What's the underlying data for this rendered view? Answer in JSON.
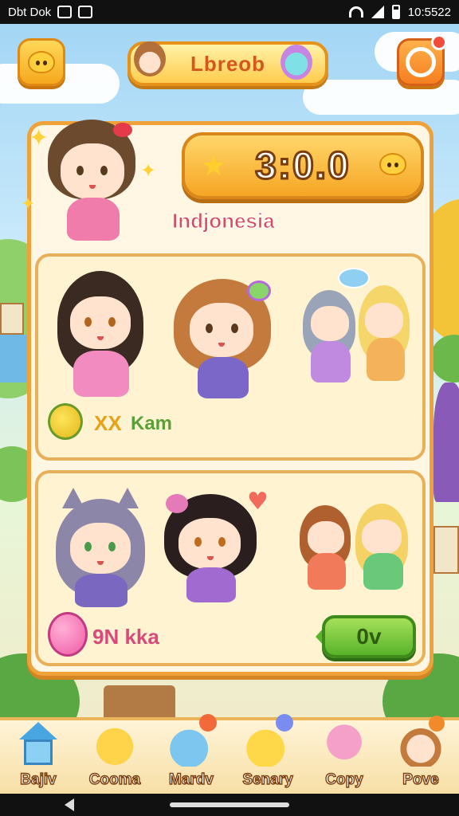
{
  "statusbar": {
    "left_text": "Dbt Dok",
    "time": "10:5522"
  },
  "header": {
    "title": "Lbreob"
  },
  "score": {
    "value": "3:0.0"
  },
  "profile": {
    "country": "Indjonesia"
  },
  "cards": [
    {
      "label": "Kam",
      "badge": "XX"
    },
    {
      "label": "9N kka"
    }
  ],
  "action_button": {
    "label": "0v"
  },
  "bottom_nav": [
    {
      "label": "Bajiv",
      "icon": "house-icon"
    },
    {
      "label": "Cooma",
      "icon": "cat-icon"
    },
    {
      "label": "Mardv",
      "icon": "bear-balloon-icon"
    },
    {
      "label": "Senary",
      "icon": "dog-balloon-icon"
    },
    {
      "label": "Copy",
      "icon": "octopus-icon"
    },
    {
      "label": "Pove",
      "icon": "girl-avatar-icon"
    }
  ],
  "colors": {
    "accent": "#efa23a",
    "panel": "#fff7e4",
    "country": "#d9495f",
    "go": "#58b42a"
  }
}
